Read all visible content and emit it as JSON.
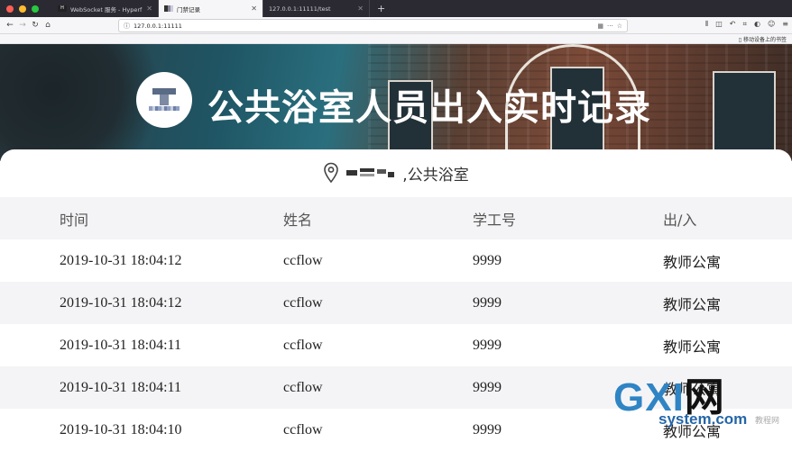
{
  "browser": {
    "tabs": [
      {
        "label": "WebSocket 服务 - Hyperf",
        "active": false
      },
      {
        "label": "门禁记录",
        "active": true
      },
      {
        "label": "127.0.0.1:11111/test",
        "active": false
      }
    ],
    "url": "127.0.0.1:11111",
    "bookmark_mobile": "移动设备上的书签"
  },
  "page": {
    "title": "公共浴室人员出入实时记录",
    "location_suffix": ",公共浴室",
    "columns": [
      "时间",
      "姓名",
      "学工号",
      "出/入"
    ],
    "rows": [
      {
        "time": "2019-10-31 18:04:12",
        "name": "ccflow",
        "id": "9999",
        "place": "教师公寓"
      },
      {
        "time": "2019-10-31 18:04:12",
        "name": "ccflow",
        "id": "9999",
        "place": "教师公寓"
      },
      {
        "time": "2019-10-31 18:04:11",
        "name": "ccflow",
        "id": "9999",
        "place": "教师公寓"
      },
      {
        "time": "2019-10-31 18:04:11",
        "name": "ccflow",
        "id": "9999",
        "place": "教师公寓"
      },
      {
        "time": "2019-10-31 18:04:10",
        "name": "ccflow",
        "id": "9999",
        "place": "教师公寓"
      }
    ]
  },
  "watermark": {
    "brand_left": "GXI",
    "brand_right": "网",
    "domain": "system.com",
    "extra": "教程网"
  },
  "colors": {
    "accent": "#2f84c4",
    "row_alt": "#f4f4f6",
    "tabbar": "#2b2a33"
  }
}
